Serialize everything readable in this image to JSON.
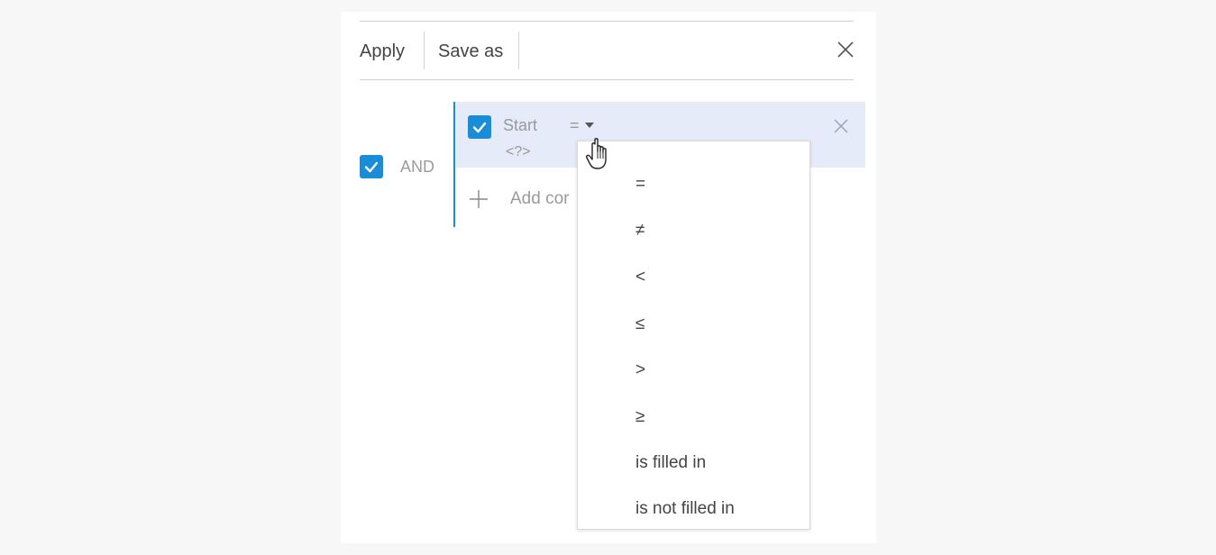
{
  "toolbar": {
    "apply_label": "Apply",
    "save_as_label": "Save as",
    "close_icon": "close-icon"
  },
  "group": {
    "checked": true,
    "logic_label": "AND"
  },
  "condition": {
    "checked": true,
    "field": "Start",
    "operator": "=",
    "value": "<?>",
    "remove_icon": "close-icon"
  },
  "add_condition": {
    "label": "Add cor",
    "icon": "plus-icon"
  },
  "operator_dropdown": {
    "items": [
      "=",
      "≠",
      "<",
      "≤",
      ">",
      "≥",
      "is filled in",
      "is not filled in"
    ]
  },
  "colors": {
    "accent": "#1a8dd9",
    "row_highlight": "#e5ebf9",
    "background": "#f7f7f7",
    "panel": "#ffffff"
  }
}
